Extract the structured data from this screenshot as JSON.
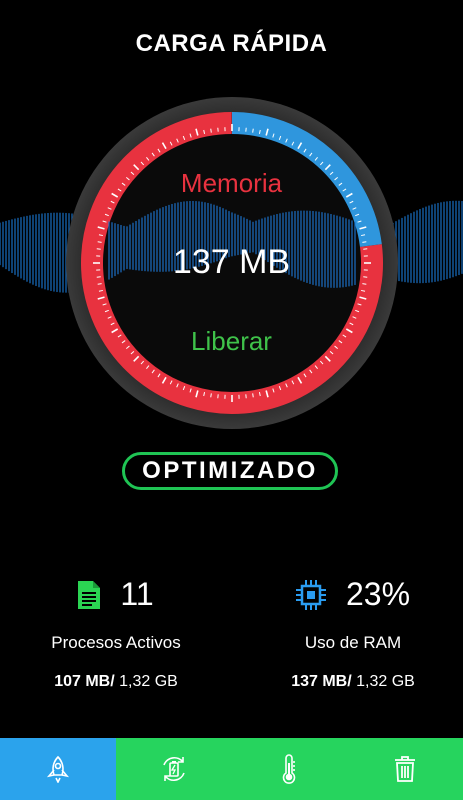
{
  "header": {
    "title": "CARGA RÁPIDA"
  },
  "gauge": {
    "top_label": "Memoria",
    "value": "137 MB",
    "bottom_label": "Liberar",
    "used_fraction": 0.23,
    "colors": {
      "used": "#2f96dd",
      "free": "#e8323f",
      "wave": "#1c78d4"
    }
  },
  "action": {
    "optimize_label": "OPTIMIZADO",
    "border_color": "#1fc454"
  },
  "stats": {
    "processes": {
      "count": "11",
      "label": "Procesos Activos",
      "size_bold": "107 MB/",
      "size_total": " 1,32 GB",
      "icon": "document-icon"
    },
    "ram": {
      "percent": "23%",
      "label": "Uso de RAM",
      "size_bold": "137 MB/",
      "size_total": " 1,32 GB",
      "icon": "chip-icon"
    }
  },
  "nav": {
    "items": [
      {
        "icon": "rocket-icon",
        "active": true
      },
      {
        "icon": "battery-refresh-icon",
        "active": false
      },
      {
        "icon": "thermometer-icon",
        "active": false
      },
      {
        "icon": "trash-icon",
        "active": false
      }
    ],
    "active_color": "#2ba3ec",
    "bg_color": "#26d45e"
  }
}
